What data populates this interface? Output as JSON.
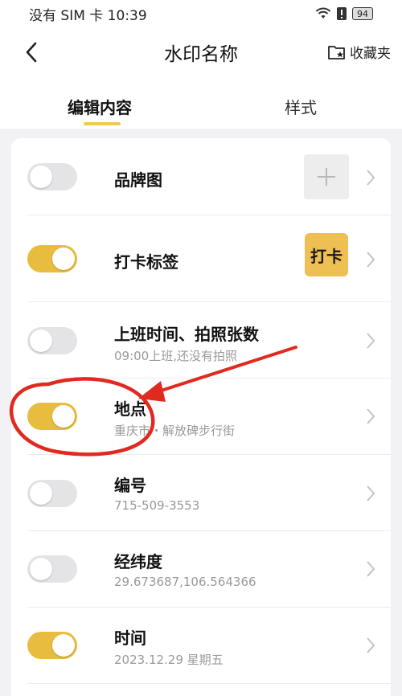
{
  "status_bar": {
    "carrier_time": "没有 SIM 卡 10:39",
    "battery_level": "94"
  },
  "header": {
    "title": "水印名称",
    "collect_label": "收藏夹"
  },
  "tabs": {
    "edit": "编辑内容",
    "style": "样式"
  },
  "items": [
    {
      "title": "品牌图",
      "enabled": false
    },
    {
      "title": "打卡标签",
      "enabled": true,
      "badge": "打卡"
    },
    {
      "title": "上班时间、拍照张数",
      "subtitle": "09:00上班,还没有拍照",
      "enabled": false
    },
    {
      "title": "地点",
      "subtitle": "重庆市・解放碑步行街",
      "enabled": true
    },
    {
      "title": "编号",
      "subtitle": "715-509-3553",
      "enabled": false
    },
    {
      "title": "经纬度",
      "subtitle": "29.673687,106.564366",
      "enabled": false
    },
    {
      "title": "时间",
      "subtitle": "2023.12.29 星期五",
      "enabled": true
    }
  ],
  "colors": {
    "accent": "#e8bd3f",
    "annotation_red": "#e02a20"
  }
}
